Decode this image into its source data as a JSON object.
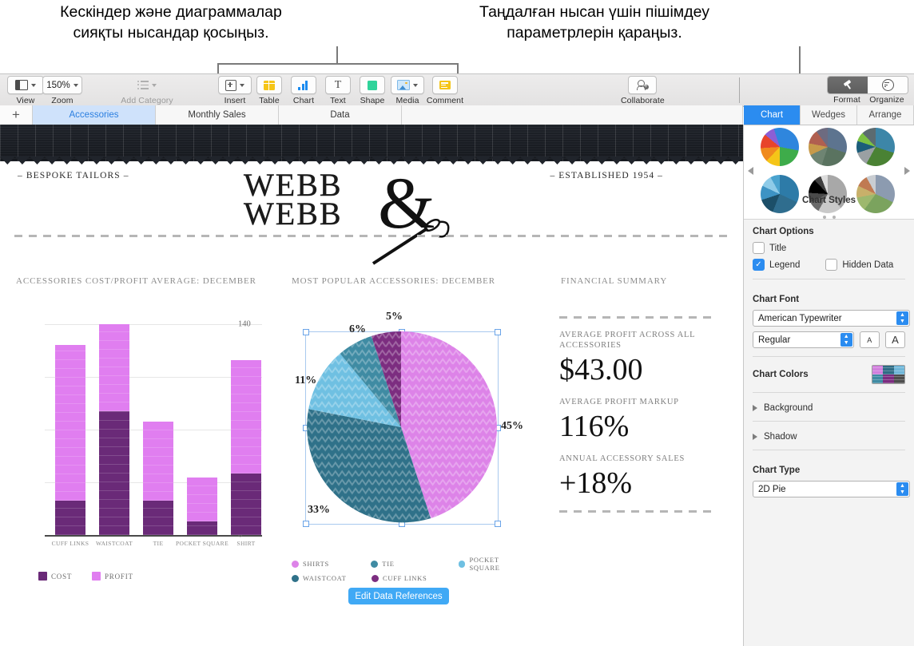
{
  "callouts": {
    "left": "Кескіндер және диаграммалар\nсияқты нысандар қосыңыз.",
    "right": "Таңдалған нысан үшін пішімдеу\nпараметрлерін қараңыз."
  },
  "toolbar": {
    "view": "View",
    "zoom_value": "150%",
    "zoom": "Zoom",
    "add_category": "Add Category",
    "insert": "Insert",
    "table": "Table",
    "chart": "Chart",
    "text": "Text",
    "shape": "Shape",
    "media": "Media",
    "comment": "Comment",
    "collaborate": "Collaborate",
    "format": "Format",
    "organize": "Organize"
  },
  "tabs": {
    "add": "+",
    "items": [
      {
        "label": "Accessories",
        "active": true
      },
      {
        "label": "Monthly Sales",
        "active": false
      },
      {
        "label": "Data",
        "active": false
      }
    ]
  },
  "document": {
    "header_left": "– BESPOKE TAILORS –",
    "header_right": "– ESTABLISHED 1954 –",
    "logo_line1": "WEBB",
    "logo_line2": "WEBB",
    "logo_amp": "&",
    "bar_title": "ACCESSORIES COST/PROFIT AVERAGE: DECEMBER",
    "pie_title": "MOST POPULAR ACCESSORIES: DECEMBER",
    "fin_title": "FINANCIAL SUMMARY",
    "edit_data_button": "Edit Data References"
  },
  "financial": [
    {
      "label": "AVERAGE PROFIT ACROSS ALL ACCESSORIES",
      "value": "$43.00"
    },
    {
      "label": "AVERAGE PROFIT MARKUP",
      "value": "116%"
    },
    {
      "label": "ANNUAL ACCESSORY SALES",
      "value": "+18%"
    }
  ],
  "chart_data": [
    {
      "type": "bar",
      "title": "ACCESSORIES COST/PROFIT AVERAGE: DECEMBER",
      "stacked": true,
      "categories": [
        "CUFF LINKS",
        "WAISTCOAT",
        "TIE",
        "POCKET SQUARE",
        "SHIRT"
      ],
      "series": [
        {
          "name": "COST",
          "color": "#6a2a78",
          "values": [
            23,
            82,
            23,
            9,
            41
          ]
        },
        {
          "name": "PROFIT",
          "color": "#e07ef0",
          "values": [
            103,
            58,
            52,
            29,
            75
          ]
        }
      ],
      "totals": [
        126,
        140,
        75,
        38,
        116
      ],
      "ylabel": "",
      "xlabel": "",
      "ylim": [
        0,
        140
      ],
      "yticks": [
        0,
        35,
        70,
        105,
        140
      ],
      "grid": true,
      "legend": [
        "COST",
        "PROFIT"
      ],
      "legend_position": "bottom-left"
    },
    {
      "type": "pie",
      "title": "MOST POPULAR ACCESSORIES: DECEMBER",
      "categories": [
        "SHIRTS",
        "WAISTCOAT",
        "POCKET SQUARE",
        "TIE",
        "CUFF LINKS"
      ],
      "values": [
        45,
        33,
        11,
        6,
        5
      ],
      "labels": [
        "45%",
        "33%",
        "11%",
        "6%",
        "5%"
      ],
      "colors": [
        "#dd83e8",
        "#2f7189",
        "#6fc0e2",
        "#3f8ba3",
        "#7c2d80"
      ],
      "legend_order": [
        "SHIRTS",
        "TIE",
        "POCKET SQUARE",
        "WAISTCOAT",
        "CUFF LINKS"
      ],
      "legend_position": "bottom",
      "selected": true
    }
  ],
  "inspector": {
    "tabs": [
      {
        "label": "Chart",
        "active": true
      },
      {
        "label": "Wedges",
        "active": false
      },
      {
        "label": "Arrange",
        "active": false
      }
    ],
    "styles_caption": "Chart Styles",
    "chart_options_title": "Chart Options",
    "option_title": "Title",
    "option_legend": "Legend",
    "option_hidden_data": "Hidden Data",
    "title_checked": false,
    "legend_checked": true,
    "hidden_data_checked": false,
    "chart_font_title": "Chart Font",
    "font_family": "American Typewriter",
    "font_style": "Regular",
    "font_small": "A",
    "font_large": "A",
    "chart_colors_title": "Chart Colors",
    "background": "Background",
    "shadow": "Shadow",
    "chart_type_title": "Chart Type",
    "chart_type": "2D Pie",
    "swatch_colors": [
      "#d17fdd",
      "#2f6c85",
      "#6fb6d8",
      "#3f8ba3",
      "#7c2d80",
      "#4d4d4d"
    ]
  },
  "colors": {
    "accent": "#2b8cf0",
    "cost": "#6a2a78",
    "profit": "#e07ef0"
  }
}
